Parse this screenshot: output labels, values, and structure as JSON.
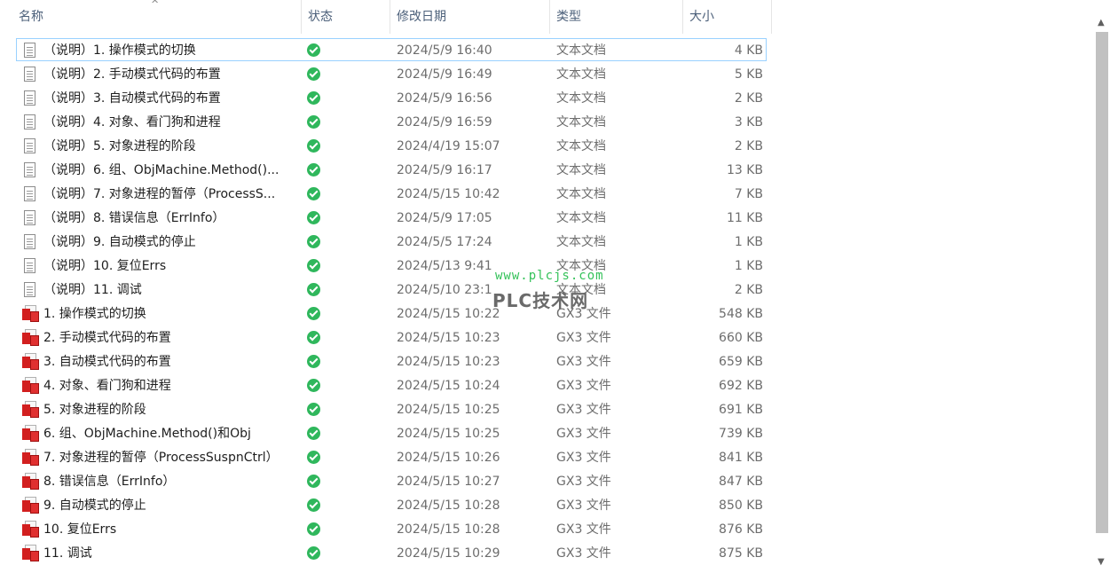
{
  "columns": {
    "name": "名称",
    "status": "状态",
    "modified": "修改日期",
    "type": "类型",
    "size": "大小"
  },
  "rows": [
    {
      "icon": "text-document-icon",
      "name": "（说明）1. 操作模式的切换",
      "status": "synced",
      "date": "2024/5/9 16:40",
      "type": "文本文档",
      "size": "4 KB"
    },
    {
      "icon": "text-document-icon",
      "name": "（说明）2. 手动模式代码的布置",
      "status": "synced",
      "date": "2024/5/9 16:49",
      "type": "文本文档",
      "size": "5 KB"
    },
    {
      "icon": "text-document-icon",
      "name": "（说明）3. 自动模式代码的布置",
      "status": "synced",
      "date": "2024/5/9 16:56",
      "type": "文本文档",
      "size": "2 KB"
    },
    {
      "icon": "text-document-icon",
      "name": "（说明）4. 对象、看门狗和进程",
      "status": "synced",
      "date": "2024/5/9 16:59",
      "type": "文本文档",
      "size": "3 KB"
    },
    {
      "icon": "text-document-icon",
      "name": "（说明）5. 对象进程的阶段",
      "status": "synced",
      "date": "2024/4/19 15:07",
      "type": "文本文档",
      "size": "2 KB"
    },
    {
      "icon": "text-document-icon",
      "name": "（说明）6. 组、ObjMachine.Method()...",
      "status": "synced",
      "date": "2024/5/9 16:17",
      "type": "文本文档",
      "size": "13 KB"
    },
    {
      "icon": "text-document-icon",
      "name": "（说明）7. 对象进程的暂停（ProcessS...",
      "status": "synced",
      "date": "2024/5/15 10:42",
      "type": "文本文档",
      "size": "7 KB"
    },
    {
      "icon": "text-document-icon",
      "name": "（说明）8. 错误信息（ErrInfo）",
      "status": "synced",
      "date": "2024/5/9 17:05",
      "type": "文本文档",
      "size": "11 KB"
    },
    {
      "icon": "text-document-icon",
      "name": "（说明）9. 自动模式的停止",
      "status": "synced",
      "date": "2024/5/5 17:24",
      "type": "文本文档",
      "size": "1 KB"
    },
    {
      "icon": "text-document-icon",
      "name": "（说明）10. 复位Errs",
      "status": "synced",
      "date": "2024/5/13 9:41",
      "type": "文本文档",
      "size": "1 KB"
    },
    {
      "icon": "text-document-icon",
      "name": "（说明）11. 调试",
      "status": "synced",
      "date": "2024/5/10 23:1",
      "type": "文本文档",
      "size": "2 KB"
    },
    {
      "icon": "gx3-file-icon",
      "name": "1. 操作模式的切换",
      "status": "synced",
      "date": "2024/5/15 10:22",
      "type": "GX3 文件",
      "size": "548 KB"
    },
    {
      "icon": "gx3-file-icon",
      "name": "2. 手动模式代码的布置",
      "status": "synced",
      "date": "2024/5/15 10:23",
      "type": "GX3 文件",
      "size": "660 KB"
    },
    {
      "icon": "gx3-file-icon",
      "name": "3. 自动模式代码的布置",
      "status": "synced",
      "date": "2024/5/15 10:23",
      "type": "GX3 文件",
      "size": "659 KB"
    },
    {
      "icon": "gx3-file-icon",
      "name": "4. 对象、看门狗和进程",
      "status": "synced",
      "date": "2024/5/15 10:24",
      "type": "GX3 文件",
      "size": "692 KB"
    },
    {
      "icon": "gx3-file-icon",
      "name": "5. 对象进程的阶段",
      "status": "synced",
      "date": "2024/5/15 10:25",
      "type": "GX3 文件",
      "size": "691 KB"
    },
    {
      "icon": "gx3-file-icon",
      "name": "6. 组、ObjMachine.Method()和Obj",
      "status": "synced",
      "date": "2024/5/15 10:25",
      "type": "GX3 文件",
      "size": "739 KB"
    },
    {
      "icon": "gx3-file-icon",
      "name": "7. 对象进程的暂停（ProcessSuspnCtrl）",
      "status": "synced",
      "date": "2024/5/15 10:26",
      "type": "GX3 文件",
      "size": "841 KB"
    },
    {
      "icon": "gx3-file-icon",
      "name": "8. 错误信息（ErrInfo）",
      "status": "synced",
      "date": "2024/5/15 10:27",
      "type": "GX3 文件",
      "size": "847 KB"
    },
    {
      "icon": "gx3-file-icon",
      "name": "9. 自动模式的停止",
      "status": "synced",
      "date": "2024/5/15 10:28",
      "type": "GX3 文件",
      "size": "850 KB"
    },
    {
      "icon": "gx3-file-icon",
      "name": "10. 复位Errs",
      "status": "synced",
      "date": "2024/5/15 10:28",
      "type": "GX3 文件",
      "size": "876 KB"
    },
    {
      "icon": "gx3-file-icon",
      "name": "11. 调试",
      "status": "synced",
      "date": "2024/5/15 10:29",
      "type": "GX3 文件",
      "size": "875 KB"
    }
  ],
  "watermark": {
    "url": "www.plcjs.com",
    "text": "PLC技术网"
  },
  "colors": {
    "synced_green": "#2fb75c",
    "selection_border": "#99d1ff",
    "header_text": "#4c607a"
  }
}
